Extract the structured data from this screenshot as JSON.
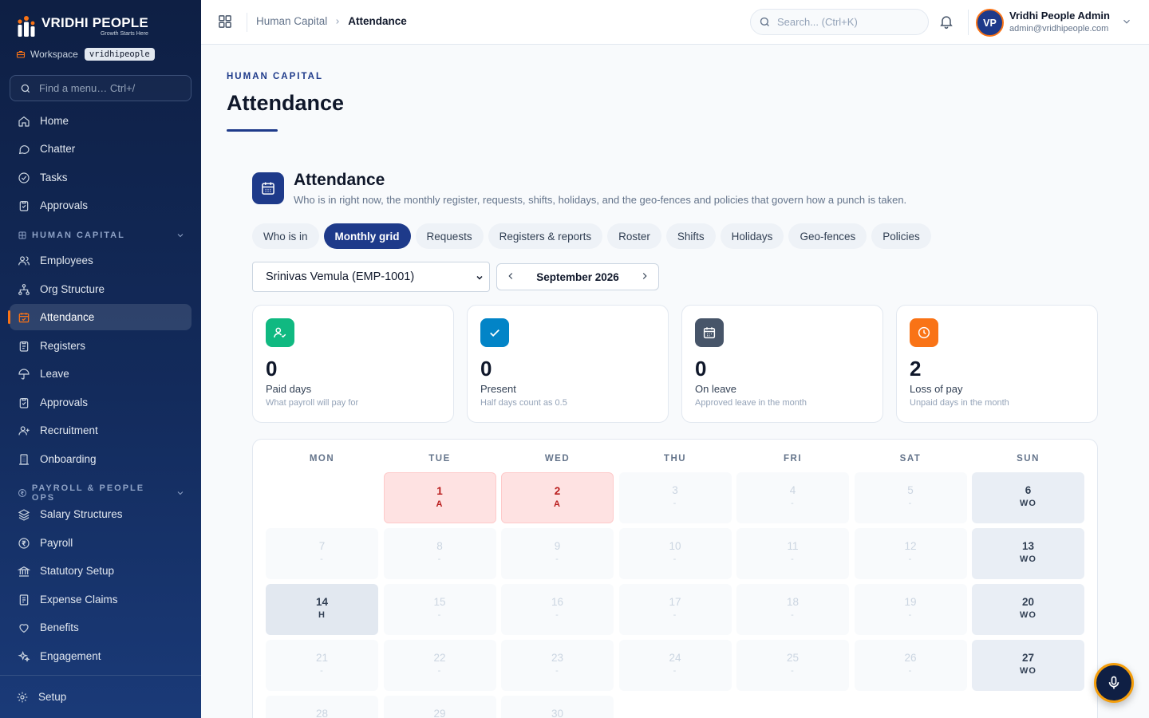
{
  "brand": {
    "name": "VRIDHI PEOPLE",
    "tagline": "Growth Starts Here"
  },
  "workspace": {
    "label": "Workspace",
    "value": "vridhipeople"
  },
  "sidebar": {
    "search_placeholder": "Find a menu… Ctrl+/",
    "top_items": [
      {
        "label": "Home",
        "icon": "home-icon"
      },
      {
        "label": "Chatter",
        "icon": "chat-icon"
      },
      {
        "label": "Tasks",
        "icon": "check-circle-icon"
      },
      {
        "label": "Approvals",
        "icon": "clipboard-icon"
      }
    ],
    "sections": [
      {
        "label": "HUMAN CAPITAL",
        "items": [
          {
            "label": "Employees",
            "icon": "users-icon"
          },
          {
            "label": "Org Structure",
            "icon": "org-icon"
          },
          {
            "label": "Attendance",
            "icon": "calendar-check-icon",
            "active": true
          },
          {
            "label": "Registers",
            "icon": "clipboard-icon"
          },
          {
            "label": "Leave",
            "icon": "umbrella-icon"
          },
          {
            "label": "Approvals",
            "icon": "clipboard-check-icon"
          },
          {
            "label": "Recruitment",
            "icon": "user-plus-icon"
          },
          {
            "label": "Onboarding",
            "icon": "building-icon"
          }
        ]
      },
      {
        "label": "PAYROLL & PEOPLE OPS",
        "items": [
          {
            "label": "Salary Structures",
            "icon": "layers-icon"
          },
          {
            "label": "Payroll",
            "icon": "rupee-icon"
          },
          {
            "label": "Statutory Setup",
            "icon": "bank-icon"
          },
          {
            "label": "Expense Claims",
            "icon": "receipt-icon"
          },
          {
            "label": "Benefits",
            "icon": "heart-icon"
          },
          {
            "label": "Engagement",
            "icon": "sparkle-icon"
          }
        ]
      }
    ],
    "setup_label": "Setup"
  },
  "topbar": {
    "breadcrumb": [
      "Human Capital",
      "Attendance"
    ],
    "search_placeholder": "Search... (Ctrl+K)",
    "user": {
      "initials": "VP",
      "name": "Vridhi People Admin",
      "email": "admin@vridhipeople.com"
    }
  },
  "page": {
    "eyebrow": "HUMAN CAPITAL",
    "title": "Attendance",
    "module_title": "Attendance",
    "module_desc": "Who is in right now, the monthly register, requests, shifts, holidays, and the geo-fences and policies that govern how a punch is taken."
  },
  "tabs": [
    "Who is in",
    "Monthly grid",
    "Requests",
    "Registers & reports",
    "Roster",
    "Shifts",
    "Holidays",
    "Geo-fences",
    "Policies"
  ],
  "active_tab": "Monthly grid",
  "employee_select": "Srinivas Vemula (EMP-1001)",
  "month": "September 2026",
  "stats": [
    {
      "value": "0",
      "label": "Paid days",
      "sub": "What payroll will pay for",
      "color": "#10b981",
      "icon": "user-check-icon"
    },
    {
      "value": "0",
      "label": "Present",
      "sub": "Half days count as 0.5",
      "color": "#0284c7",
      "icon": "check-icon"
    },
    {
      "value": "0",
      "label": "On leave",
      "sub": "Approved leave in the month",
      "color": "#475569",
      "icon": "calendar-icon"
    },
    {
      "value": "2",
      "label": "Loss of pay",
      "sub": "Unpaid days in the month",
      "color": "#f97316",
      "icon": "clock-icon"
    }
  ],
  "calendar": {
    "weekdays": [
      "MON",
      "TUE",
      "WED",
      "THU",
      "FRI",
      "SAT",
      "SUN"
    ],
    "days": [
      {
        "d": "1",
        "s": "A",
        "t": "absent"
      },
      {
        "d": "2",
        "s": "A",
        "t": "absent"
      },
      {
        "d": "3",
        "s": "-",
        "t": ""
      },
      {
        "d": "4",
        "s": "-",
        "t": ""
      },
      {
        "d": "5",
        "s": "-",
        "t": ""
      },
      {
        "d": "6",
        "s": "WO",
        "t": "wo"
      },
      {
        "d": "7",
        "s": "-",
        "t": ""
      },
      {
        "d": "8",
        "s": "-",
        "t": ""
      },
      {
        "d": "9",
        "s": "-",
        "t": ""
      },
      {
        "d": "10",
        "s": "-",
        "t": ""
      },
      {
        "d": "11",
        "s": "-",
        "t": ""
      },
      {
        "d": "12",
        "s": "-",
        "t": ""
      },
      {
        "d": "13",
        "s": "WO",
        "t": "wo"
      },
      {
        "d": "14",
        "s": "H",
        "t": "hol"
      },
      {
        "d": "15",
        "s": "-",
        "t": ""
      },
      {
        "d": "16",
        "s": "-",
        "t": ""
      },
      {
        "d": "17",
        "s": "-",
        "t": ""
      },
      {
        "d": "18",
        "s": "-",
        "t": ""
      },
      {
        "d": "19",
        "s": "-",
        "t": ""
      },
      {
        "d": "20",
        "s": "WO",
        "t": "wo"
      },
      {
        "d": "21",
        "s": "-",
        "t": ""
      },
      {
        "d": "22",
        "s": "-",
        "t": ""
      },
      {
        "d": "23",
        "s": "-",
        "t": ""
      },
      {
        "d": "24",
        "s": "-",
        "t": ""
      },
      {
        "d": "25",
        "s": "-",
        "t": ""
      },
      {
        "d": "26",
        "s": "-",
        "t": ""
      },
      {
        "d": "27",
        "s": "WO",
        "t": "wo"
      },
      {
        "d": "28",
        "s": "-",
        "t": ""
      },
      {
        "d": "29",
        "s": "-",
        "t": ""
      },
      {
        "d": "30",
        "s": "-",
        "t": ""
      }
    ]
  }
}
